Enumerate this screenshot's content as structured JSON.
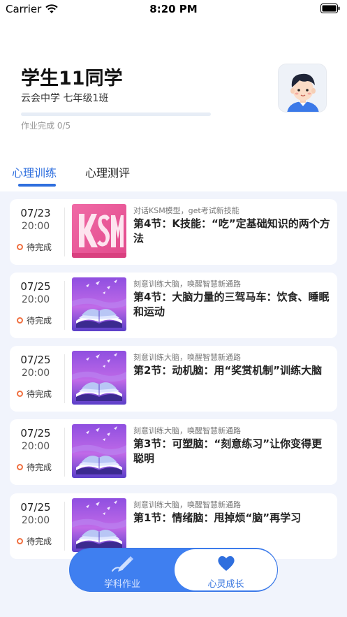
{
  "status_bar": {
    "carrier": "Carrier",
    "time": "8:20 PM"
  },
  "header": {
    "name": "学生11同学",
    "class_info": "云会中学 七年级1班",
    "progress_text": "作业完成 0/5",
    "progress_fraction": 0
  },
  "tabs": [
    {
      "label": "心理训练",
      "active": true
    },
    {
      "label": "心理测评",
      "active": false
    }
  ],
  "cards": [
    {
      "date": "07/23",
      "time": "20:00",
      "status": "待完成",
      "subtitle": "对话KSM模型，get考试新技能",
      "title": "第4节：K技能：“吃”定基础知识的两个方法",
      "thumb": "ksm"
    },
    {
      "date": "07/25",
      "time": "20:00",
      "status": "待完成",
      "subtitle": "刻意训练大脑，唤醒智慧新通路",
      "title": "第4节：大脑力量的三驾马车：饮食、睡眠和运动",
      "thumb": "book"
    },
    {
      "date": "07/25",
      "time": "20:00",
      "status": "待完成",
      "subtitle": "刻意训练大脑，唤醒智慧新通路",
      "title": "第2节：动机脑：用“奖赏机制”训练大脑",
      "thumb": "book"
    },
    {
      "date": "07/25",
      "time": "20:00",
      "status": "待完成",
      "subtitle": "刻意训练大脑，唤醒智慧新通路",
      "title": "第3节：可塑脑：“刻意练习”让你变得更聪明",
      "thumb": "book"
    },
    {
      "date": "07/25",
      "time": "20:00",
      "status": "待完成",
      "subtitle": "刻意训练大脑，唤醒智慧新通路",
      "title": "第1节：情绪脑：甩掉烦“脑”再学习",
      "thumb": "book"
    }
  ],
  "bottom_nav": {
    "left_label": "学科作业",
    "right_label": "心灵成长",
    "left_icon": "pencil-icon",
    "right_icon": "heart-icon",
    "accent": "#3f7ff0"
  }
}
